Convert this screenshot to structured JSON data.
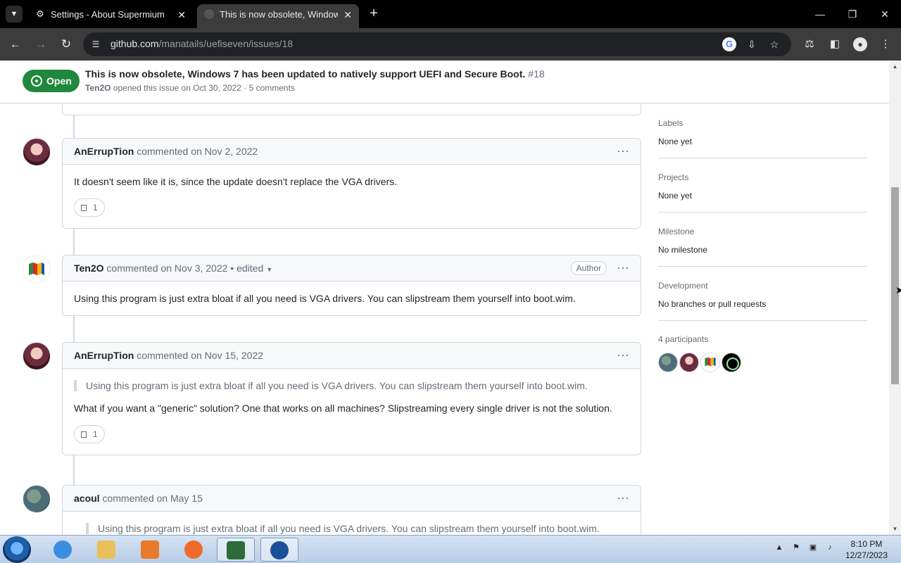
{
  "browser": {
    "tabs": [
      {
        "title": "Settings - About Supermium",
        "icon": "gear-icon"
      },
      {
        "title": "This is now obsolete, Windows",
        "icon": "github-icon"
      }
    ],
    "address": {
      "domain": "github.com",
      "path": "/manatails/uefiseven/issues/18"
    }
  },
  "issue": {
    "state": "Open",
    "title": "This is now obsolete, Windows 7 has been updated to natively support UEFI and Secure Boot.",
    "number": "#18",
    "author": "Ten2O",
    "opened_text": "opened this issue on Oct 30, 2022 · 5 comments"
  },
  "comments": [
    {
      "author": "AnErrupTion",
      "meta": "commented on Nov 2, 2022",
      "body": "It doesn't seem like it is, since the update doesn't replace the VGA drivers.",
      "reaction_count": "1"
    },
    {
      "author": "Ten2O",
      "meta": "commented on Nov 3, 2022 • edited",
      "role": "Author",
      "body": "Using this program is just extra bloat if all you need is VGA drivers. You can slipstream them yourself into boot.wim."
    },
    {
      "author": "AnErrupTion",
      "meta": "commented on Nov 15, 2022",
      "quote": "Using this program is just extra bloat if all you need is VGA drivers. You can slipstream them yourself into boot.wim.",
      "body": "What if you want a \"generic\" solution? One that works on all machines? Slipstreaming every single driver is not the solution.",
      "reaction_count": "1"
    },
    {
      "author": "acoul",
      "meta": "commented on May 15",
      "quote": "Using this program is just extra bloat if all you need is VGA drivers. You can slipstream them yourself into boot.wim."
    }
  ],
  "sidebar": {
    "labels": {
      "label": "Labels",
      "value": "None yet"
    },
    "projects": {
      "label": "Projects",
      "value": "None yet"
    },
    "milestone": {
      "label": "Milestone",
      "value": "No milestone"
    },
    "development": {
      "label": "Development",
      "value": "No branches or pull requests"
    },
    "participants_label": "4 participants"
  },
  "taskbar": {
    "time": "8:10 PM",
    "date": "12/27/2023"
  },
  "colors": {
    "open_green": "#1f883d",
    "chrome_dark": "#3c3c3c",
    "border": "#d0d7de"
  }
}
